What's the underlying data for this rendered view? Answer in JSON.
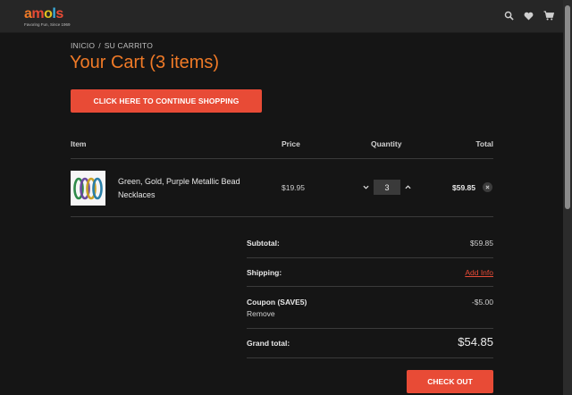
{
  "header": {
    "logo_letters": [
      "a",
      "m",
      "o",
      "l",
      "s"
    ],
    "logo_colors": [
      "#f07a27",
      "#e84b36",
      "#e0c21e",
      "#3bb0e0",
      "#e84b36"
    ],
    "logo_tagline": "Favoring Fun, Since 1969",
    "icons": [
      "search-icon",
      "heart-icon",
      "cart-icon"
    ]
  },
  "breadcrumb": {
    "home": "INICIO",
    "separator": "/",
    "current": "SU CARRITO"
  },
  "page_title": "Your Cart (3 items)",
  "continue_button": "CLICK HERE TO CONTINUE SHOPPING",
  "table": {
    "headers": {
      "item": "Item",
      "price": "Price",
      "quantity": "Quantity",
      "total": "Total"
    },
    "rows": [
      {
        "name": "Green, Gold, Purple Metallic Bead Necklaces",
        "price": "$19.95",
        "quantity": "3",
        "total": "$59.85"
      }
    ]
  },
  "summary": {
    "subtotal_label": "Subtotal:",
    "subtotal_value": "$59.85",
    "shipping_label": "Shipping:",
    "shipping_value": "Add Info",
    "coupon_label": "Coupon (SAVE5)",
    "coupon_value": "-$5.00",
    "coupon_remove": "Remove",
    "grand_label": "Grand total:",
    "grand_value": "$54.85"
  },
  "checkout_button": "CHECK OUT",
  "colors": {
    "accent": "#e84b36",
    "title": "#f07a27",
    "background": "#151515"
  }
}
